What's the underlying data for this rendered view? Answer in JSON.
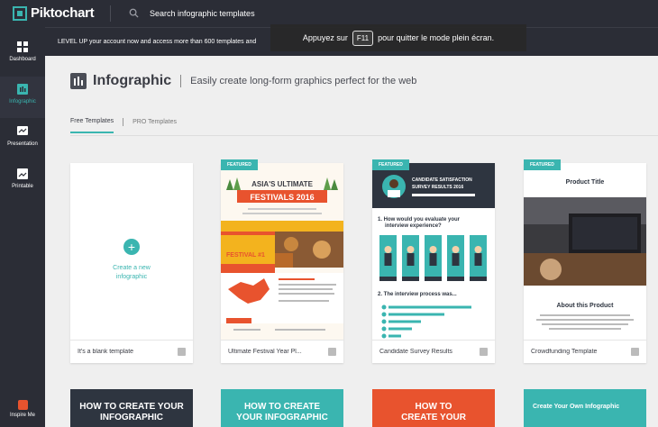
{
  "app": {
    "brand": "Piktochart"
  },
  "search": {
    "placeholder": "Search infographic templates"
  },
  "upgrade": {
    "text": "LEVEL UP your account now and access more than 600 templates and"
  },
  "fullscreen_toast": {
    "before": "Appuyez sur",
    "key": "F11",
    "after": "pour quitter le mode plein écran."
  },
  "sidebar": {
    "items": [
      {
        "label": "Dashboard",
        "icon": "grid-icon"
      },
      {
        "label": "Infographic",
        "icon": "infographic-icon"
      },
      {
        "label": "Presentation",
        "icon": "presentation-icon"
      },
      {
        "label": "Printable",
        "icon": "printable-icon"
      }
    ],
    "inspire": "Inspire Me"
  },
  "header": {
    "title": "Infographic",
    "subtitle": "Easily create long-form graphics perfect for the web"
  },
  "tabs": [
    {
      "label": "Free Templates"
    },
    {
      "label": "PRO Templates"
    }
  ],
  "badge": "FEATURED",
  "cards": [
    {
      "name": "It's a blank template",
      "blank_label": "Create a new\ninfographic"
    },
    {
      "name": "Ultimate Festival Year Pl...",
      "thumb_title": "ASIA'S ULTIMATE",
      "thumb_title2": "FESTIVALS 2016",
      "thumb_festival": "FESTIVAL #1"
    },
    {
      "name": "Candidate Survey Results",
      "thumb_title": "CANDIDATE SATISFACTION",
      "thumb_title2": "SURVEY RESULTS 2016",
      "thumb_q1": "1.  How would you evaluate your",
      "thumb_q1b": "interview experience?",
      "thumb_q2": "2.  The interview process was..."
    },
    {
      "name": "Crowdfunding Template",
      "thumb_title": "Product Title",
      "thumb_about": "About this Product"
    }
  ],
  "bottom_cards": [
    {
      "text": "HOW TO CREATE YOUR\nINFOGRAPHIC"
    },
    {
      "text": "HOW TO CREATE\nYOUR INFOGRAPHIC"
    },
    {
      "text": "HOW TO\nCREATE YOUR"
    },
    {
      "text": "Create Your Own Infographic"
    }
  ],
  "colors": {
    "accent": "#3ab5b0",
    "topbar": "#2b2d36",
    "festival_orange": "#e8532e",
    "festival_yellow": "#f3b31e",
    "survey_dark": "#2e3540",
    "survey_teal": "#3ab5b0"
  }
}
